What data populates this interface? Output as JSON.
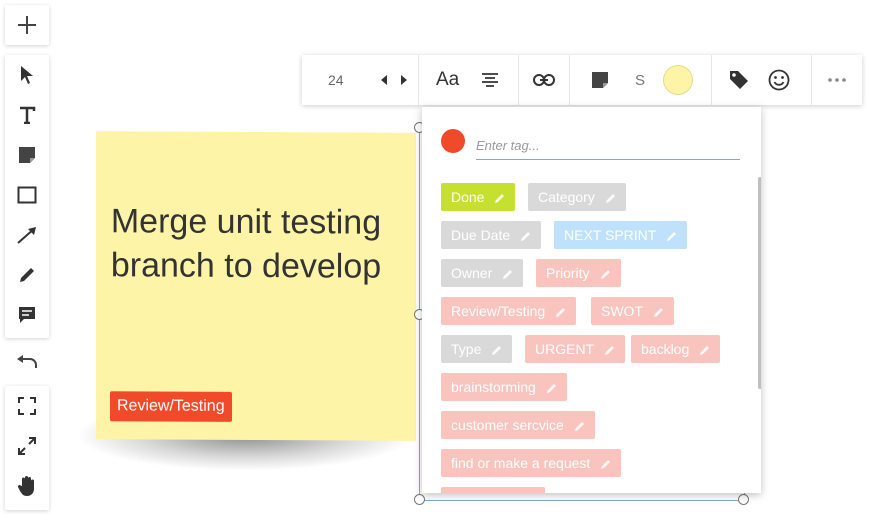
{
  "colors": {
    "note": "#fdf4a7",
    "accent_red": "#f04a2a",
    "tag_green": "#c5e02f",
    "tag_gray": "#d9d9d9",
    "tag_blue": "#bfe1fb",
    "tag_pink": "#f8c4bd"
  },
  "left_toolbar": {
    "icons": [
      "plus-icon",
      "cursor-icon",
      "text-icon",
      "sticky-note-icon",
      "rectangle-icon",
      "arrow-icon",
      "pen-icon",
      "comment-icon",
      "undo-icon",
      "fit-screen-icon",
      "fullscreen-icon",
      "hand-icon"
    ]
  },
  "top_toolbar": {
    "font_size": "24",
    "font_label": "Aa",
    "shape_label": "S"
  },
  "note": {
    "text": "Merge unit testing branch to develop",
    "tag": "Review/Testing"
  },
  "tag_panel": {
    "placeholder": "Enter tag...",
    "tags": [
      {
        "label": "Done",
        "color": "#c5e02f"
      },
      {
        "label": "Category",
        "color": "#d9d9d9"
      },
      {
        "label": "Due Date",
        "color": "#d9d9d9"
      },
      {
        "label": "NEXT SPRINT",
        "color": "#bfe1fb"
      },
      {
        "label": "Owner",
        "color": "#d9d9d9"
      },
      {
        "label": "Priority",
        "color": "#f8c4bd"
      },
      {
        "label": "Review/Testing",
        "color": "#f8c4bd"
      },
      {
        "label": "SWOT",
        "color": "#f8c4bd"
      },
      {
        "label": "Type",
        "color": "#d9d9d9"
      },
      {
        "label": "URGENT",
        "color": "#f8c4bd"
      },
      {
        "label": "backlog",
        "color": "#f8c4bd"
      },
      {
        "label": "brainstorming",
        "color": "#f8c4bd"
      },
      {
        "label": "customer sercvice",
        "color": "#f8c4bd"
      },
      {
        "label": "find or make a request",
        "color": "#f8c4bd"
      },
      {
        "label": "",
        "color": "#f8c4bd"
      }
    ]
  }
}
